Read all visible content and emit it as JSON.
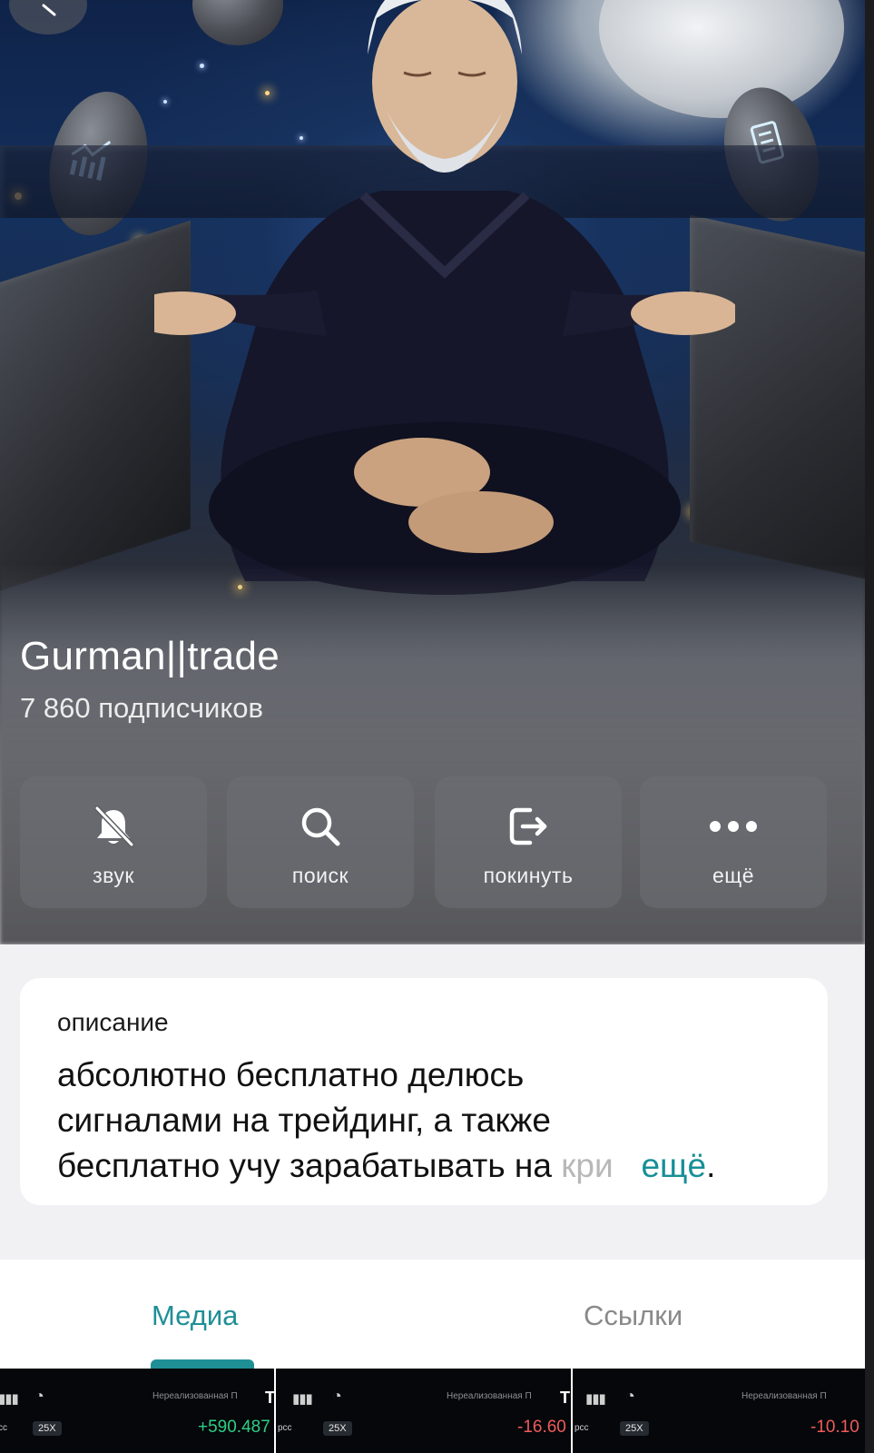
{
  "channel": {
    "title": "Gurman||trade",
    "subscribers": "7 860 подписчиков"
  },
  "actions": [
    {
      "label": "звук",
      "icon": "bell-slash-icon"
    },
    {
      "label": "поиск",
      "icon": "search-icon"
    },
    {
      "label": "покинуть",
      "icon": "leave-icon"
    },
    {
      "label": "ещё",
      "icon": "more-dots-icon"
    }
  ],
  "description": {
    "label": "описание",
    "text_line1": "абсолютно бесплатно делюсь",
    "text_line2": "сигналами на трейдинг, а также",
    "text_line3": "бесплатно учу зарабатывать на ",
    "text_fade": "кри",
    "more": "ещё",
    "period": "."
  },
  "tabs": {
    "media": "Медиа",
    "links": "Ссылки",
    "active": "media"
  },
  "media_thumbs": [
    {
      "leverage": "25X",
      "unrealized": "Нереализованная П",
      "pnl": "+590.487",
      "suffix": "T"
    },
    {
      "leverage": "25X",
      "unrealized": "Нереализованная П",
      "pnl": "-16.60",
      "suffix": "T"
    },
    {
      "leverage": "25X",
      "unrealized": "Нереализованная П",
      "pnl": "-10.10",
      "suffix": ""
    }
  ],
  "colors": {
    "accent": "#1f8f96",
    "positive": "#2ecf86",
    "negative": "#f05b5b"
  }
}
